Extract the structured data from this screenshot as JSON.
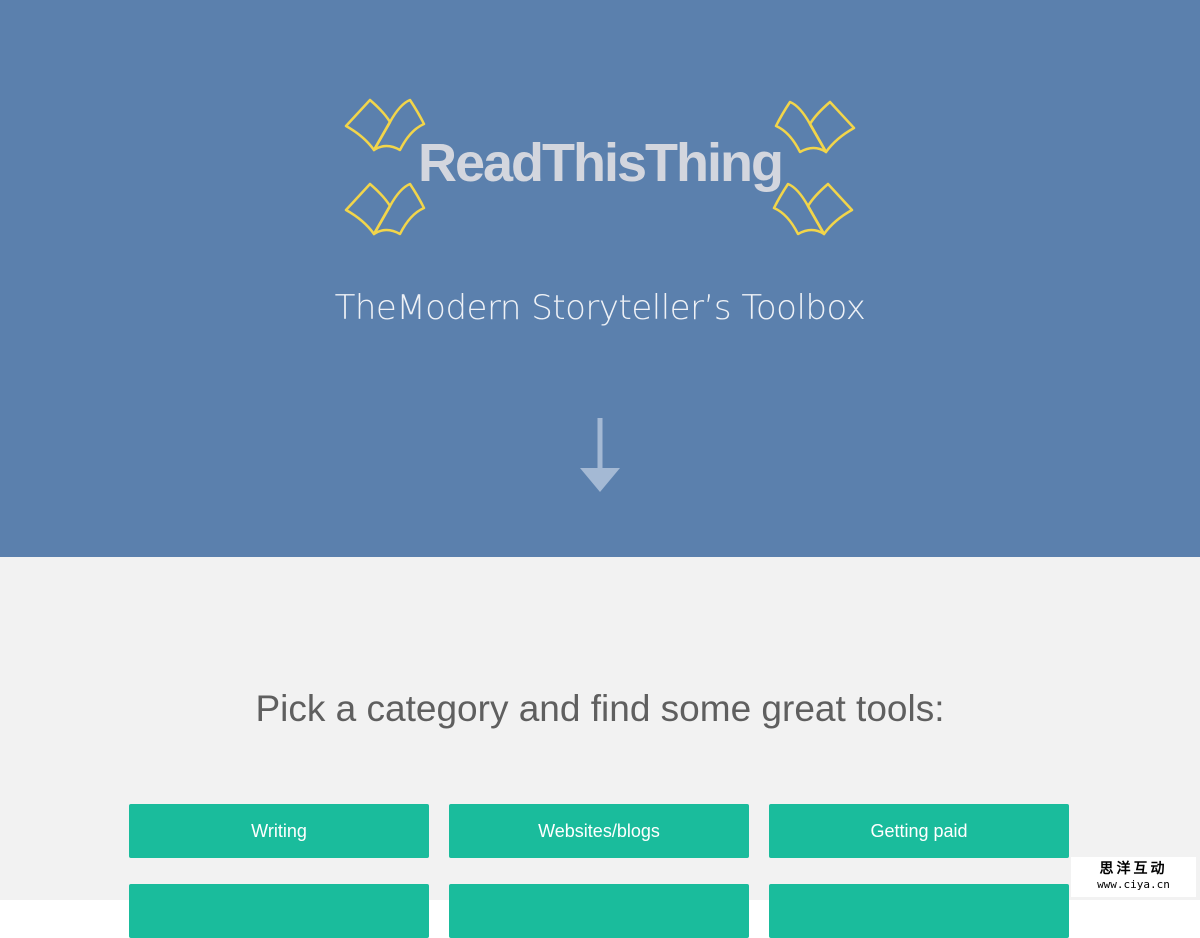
{
  "hero": {
    "logo_text": "ReadThisThing",
    "tagline": "TheModern Storyteller’s Toolbox",
    "background_color": "#5b80ad",
    "logo_icon": "open-book-icon",
    "logo_icon_color": "#f2d54a",
    "scroll_icon": "arrow-down-icon"
  },
  "categories": {
    "heading": "Pick a category and find some great tools:",
    "button_color": "#1abc9c",
    "items": [
      {
        "label": "Writing"
      },
      {
        "label": "Websites/blogs"
      },
      {
        "label": "Getting paid"
      },
      {
        "label": ""
      },
      {
        "label": ""
      },
      {
        "label": ""
      }
    ]
  },
  "watermark": {
    "chinese": "思洋互动",
    "url": "www.ciya.cn"
  }
}
